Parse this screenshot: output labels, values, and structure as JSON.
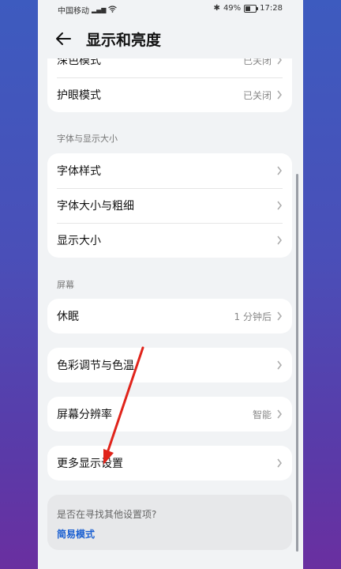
{
  "status_bar": {
    "carrier": "中国移动",
    "signal": "⁴ᴳ",
    "battery": "49%",
    "time": "17:28"
  },
  "header": {
    "title": "显示和亮度"
  },
  "top_card": {
    "items": [
      {
        "label": "深色模式",
        "value": "已关闭"
      },
      {
        "label": "护眼模式",
        "value": "已关闭"
      }
    ]
  },
  "font_section": {
    "label": "字体与显示大小",
    "items": [
      {
        "label": "字体样式"
      },
      {
        "label": "字体大小与粗细"
      },
      {
        "label": "显示大小"
      }
    ]
  },
  "screen_section": {
    "label": "屏幕",
    "sleep": {
      "label": "休眠",
      "value": "1 分钟后"
    },
    "color": {
      "label": "色彩调节与色温"
    },
    "resolution": {
      "label": "屏幕分辨率",
      "value": "智能"
    },
    "more": {
      "label": "更多显示设置"
    }
  },
  "tip": {
    "question": "是否在寻找其他设置项?",
    "link": "简易模式"
  },
  "annotation": {
    "arrow_color": "#e0241b"
  }
}
